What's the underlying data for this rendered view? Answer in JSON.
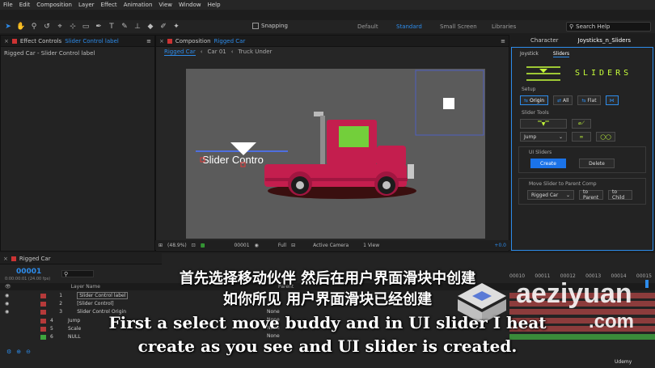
{
  "menu": [
    "File",
    "Edit",
    "Composition",
    "Layer",
    "Effect",
    "Animation",
    "View",
    "Window",
    "Help"
  ],
  "toolbar": {
    "snapping_label": "Snapping",
    "workspaces": [
      "Default",
      "Standard",
      "Small Screen",
      "Libraries"
    ],
    "active_workspace": "Standard",
    "search_placeholder": "Search Help"
  },
  "effect_controls": {
    "tab_prefix": "Effect Controls",
    "tab_layer": "Slider Control label",
    "subtitle": "Rigged Car - Slider Control label"
  },
  "composition": {
    "tab_prefix": "Composition",
    "tab_name": "Rigged Car",
    "breadcrumbs": [
      "Rigged Car",
      "Car 01",
      "Truck Under"
    ],
    "layer_text": "Slider Contro"
  },
  "viewer": {
    "zoom": "(48.9%)",
    "timecode": "00001",
    "resolution": "Full",
    "camera": "Active Camera",
    "views": "1 View",
    "offset": "+0.0"
  },
  "plugin": {
    "top_tabs": [
      "Character",
      "Joysticks_n_Sliders"
    ],
    "sub_tabs": [
      "Joystick",
      "Sliders"
    ],
    "logo_word": "SLIDERS",
    "setup_label": "Setup",
    "setup_buttons": [
      "Origin",
      "All",
      "Flat"
    ],
    "slider_tools_label": "Slider Tools",
    "jump_select": "Jump",
    "ui_sliders_label": "UI Sliders",
    "create_label": "Create",
    "delete_label": "Delete",
    "move_label": "Move Slider to Parent Comp",
    "parent_select": "Rigged Car",
    "to_parent": "to Parent",
    "to_child": "to Child"
  },
  "timeline": {
    "tab_name": "Rigged Car",
    "current_time": "00001",
    "time_sub": "0:00:00:01 (24.00 fps)",
    "col_layer_name": "Layer Name",
    "col_parent": "Parent",
    "ruler_marks": [
      "00010",
      "00011",
      "00012",
      "00013",
      "00014",
      "00015"
    ],
    "parent_values": [
      "None",
      "None",
      "None",
      "None"
    ],
    "layers": [
      {
        "num": "1",
        "name": "Slider Control label",
        "color": "#b53a3a"
      },
      {
        "num": "2",
        "name": "[Slider Control]",
        "color": "#b53a3a"
      },
      {
        "num": "3",
        "name": "Slider Control Origin",
        "color": "#b53a3a"
      },
      {
        "num": "4",
        "name": "Jump",
        "color": "#b53a3a"
      },
      {
        "num": "5",
        "name": "Scale",
        "color": "#b53a3a"
      },
      {
        "num": "6",
        "name": "NULL",
        "color": "#3ea53e"
      }
    ]
  },
  "subtitles": {
    "cn_line1": "首先选择移动伙伴 然后在用户界面滑块中创建",
    "cn_line2": "如你所见 用户界面滑块已经创建",
    "en_line1": "First a select move buddy and in UI slider I heat",
    "en_line2": "create as you see and UI slider is created."
  },
  "watermark": {
    "line1": "aeziyuan",
    "line2": ".com",
    "udemy": "Udemy"
  }
}
